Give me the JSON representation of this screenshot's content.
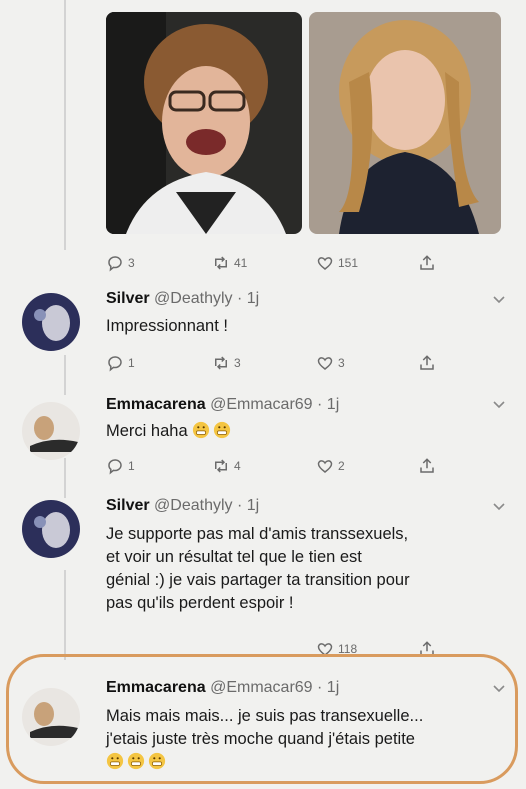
{
  "top_tweet": {
    "replies": "3",
    "retweets": "41",
    "likes": "151"
  },
  "tweets": [
    {
      "name": "Silver",
      "handle": "@Deathyly · 1j",
      "text": "Impressionnant !",
      "replies": "1",
      "retweets": "3",
      "likes": "3"
    },
    {
      "name": "Emmacarena",
      "handle": "@Emmacar69 · 1j",
      "text": "Merci haha",
      "replies": "1",
      "retweets": "4",
      "likes": "2"
    },
    {
      "name": "Silver",
      "handle": "@Deathyly · 1j",
      "text_lines": [
        "Je supporte pas mal d'amis transsexuels,",
        "et voir un résultat tel que le tien est",
        "génial :) je vais partager ta transition pour",
        "pas qu'ils perdent espoir !"
      ],
      "likes": "118"
    },
    {
      "name": "Emmacarena",
      "handle": "@Emmacar69 · 1j",
      "text_lines": [
        "Mais mais mais... je suis pas transexuelle...",
        "j'etais juste très moche quand j'étais petite"
      ]
    }
  ],
  "icons": [
    "reply-icon",
    "retweet-icon",
    "like-icon",
    "share-icon",
    "chevron-down-icon"
  ],
  "colors": {
    "background": "#f1f1ef",
    "highlight": "#d99b5e",
    "muted": "#6b6b6b"
  }
}
